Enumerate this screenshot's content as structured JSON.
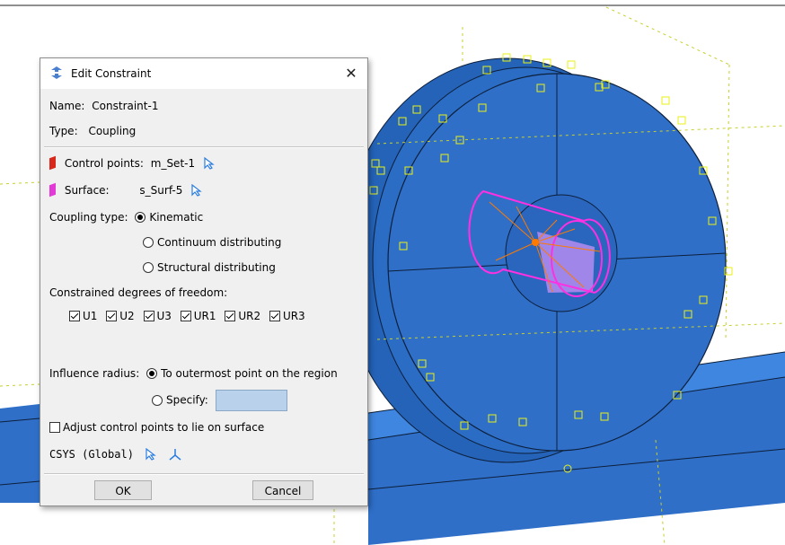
{
  "dialog": {
    "title": "Edit Constraint",
    "close_symbol": "✕",
    "name_label": "Name:",
    "name_value": "Constraint-1",
    "type_label": "Type:",
    "type_value": "Coupling",
    "control_points_label": "Control points:",
    "control_points_value": "m_Set-1",
    "surface_label": "Surface:",
    "surface_value": "s_Surf-5",
    "coupling_type_label": "Coupling type:",
    "coupling_options": [
      "Kinematic",
      "Continuum distributing",
      "Structural distributing"
    ],
    "coupling_selected": "Kinematic",
    "dof_label": "Constrained degrees of freedom:",
    "dof": [
      "U1",
      "U2",
      "U3",
      "UR1",
      "UR2",
      "UR3"
    ],
    "influence_label": "Influence radius:",
    "influence_options": [
      "To outermost point on the region",
      "Specify:"
    ],
    "influence_selected": "To outermost point on the region",
    "adjust_label": "Adjust control points to lie on surface",
    "adjust_checked": false,
    "csys_label": "CSYS (Global)",
    "ok_label": "OK",
    "cancel_label": "Cancel"
  },
  "icons": {
    "title": "constraint-icon",
    "control_points": "red-flag-icon",
    "surface": "magenta-flag-icon",
    "select": "select-arrow-icon",
    "csys": "axis-triad-icon"
  },
  "colors": {
    "part_blue": "#2f6fc8",
    "part_blue_dark": "#1f58a8",
    "edge": "#0d1f3a",
    "marker_yellow": "#e9f016",
    "coupling_magenta": "#ff2fe2",
    "coupling_orange": "#ff7a00",
    "specify_field": "#b9d1ea"
  }
}
